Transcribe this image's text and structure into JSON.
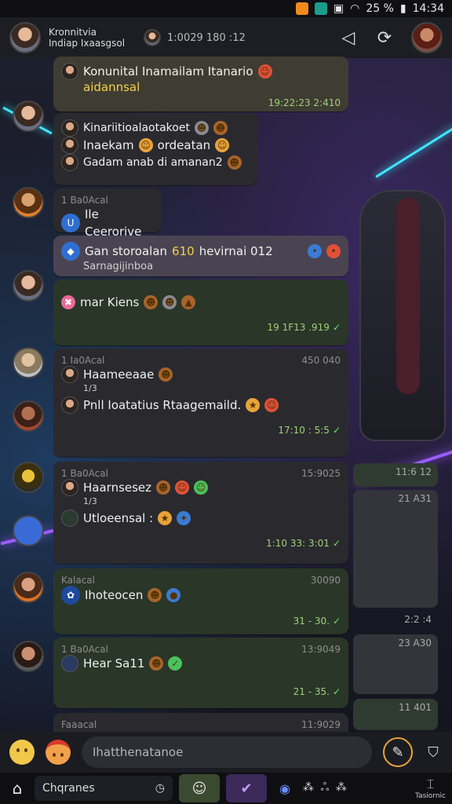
{
  "status_bar": {
    "battery": "25 %",
    "time": "14:34"
  },
  "header": {
    "title_line1": "Kronnitvia",
    "title_line2": "Indiap Ixaasgsol",
    "call_time": "1:0029 180 :12"
  },
  "messages": [
    {
      "id": "m1",
      "line1": "Konunital Inamailam Itanario",
      "line2": "aidannsal",
      "time": "19:22:23 2:410"
    },
    {
      "id": "m2",
      "line1": "Kinariitioalaotakoet",
      "line2": "Inaekam",
      "line2b": "ordeatan",
      "line3": "Gadam anab di amanan2"
    },
    {
      "id": "m3",
      "meta": "1 Ba0Acal",
      "text": "Ile Ceerorive"
    },
    {
      "id": "m4",
      "line1": "Gan storoalan",
      "line1_highlight": "610",
      "line1b": "hevirnai 012",
      "line2": "Sarnagijinboa"
    },
    {
      "id": "m5",
      "text": "mar Kiens",
      "time": "19 1F13 .919"
    },
    {
      "id": "m6",
      "meta": "1 Ia0Acal",
      "meta_right": "450 040",
      "line1": "Haameeaae",
      "line1_sub": "1/3",
      "line2": "Pnll Ioatatius Rtaagemaild.",
      "time": "17:10 : 5:5"
    },
    {
      "id": "m7",
      "meta": "1 Ba0Acal",
      "meta_right": "15:9025",
      "line1": "Haarnsesez",
      "line1_sub": "1/3",
      "line2": "Utloeensal :",
      "time": "1:10 33: 3:01"
    },
    {
      "id": "m8",
      "meta": "Kalacal",
      "meta_right": "30090",
      "text": "Ihoteocen",
      "time": "31 - 30."
    },
    {
      "id": "m9",
      "meta": "1 Ba0Acal",
      "meta_right": "13:9049",
      "text": "Hear Sa11",
      "time": "21 - 35."
    },
    {
      "id": "m10",
      "meta": "Faaacal",
      "meta_right": "11:9029"
    }
  ],
  "right_cards": [
    {
      "text": "11:6 12"
    },
    {
      "text": "21 A31"
    },
    {
      "text": "2:2 :4"
    },
    {
      "text": "23 A30"
    },
    {
      "text": "11 401"
    }
  ],
  "composer": {
    "placeholder": "Ihatthenatanoe"
  },
  "navbar": {
    "field_label": "Chqranes",
    "end_label": "Tasiornic"
  },
  "colors": {
    "accent": "#e8a33a",
    "tick": "#6ee06a",
    "bubble_green": "#2a3628"
  }
}
